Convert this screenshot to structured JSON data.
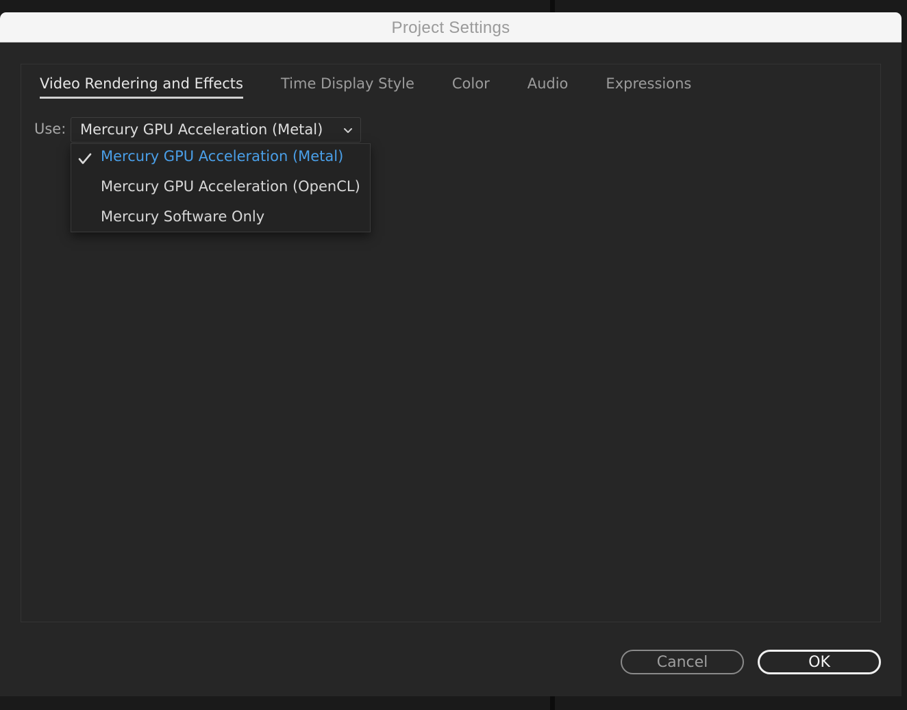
{
  "window": {
    "title": "Project Settings"
  },
  "tabs": [
    {
      "label": "Video Rendering and Effects",
      "active": true
    },
    {
      "label": "Time Display Style",
      "active": false
    },
    {
      "label": "Color",
      "active": false
    },
    {
      "label": "Audio",
      "active": false
    },
    {
      "label": "Expressions",
      "active": false
    }
  ],
  "renderer": {
    "use_label": "Use:",
    "selected_value": "Mercury GPU Acceleration (Metal)",
    "options": [
      {
        "label": "Mercury GPU Acceleration (Metal)",
        "selected": true
      },
      {
        "label": "Mercury GPU Acceleration (OpenCL)",
        "selected": false
      },
      {
        "label": "Mercury Software Only",
        "selected": false
      }
    ]
  },
  "buttons": {
    "cancel_label": "Cancel",
    "ok_label": "OK"
  },
  "colors": {
    "dialog_background": "#262626",
    "selected_option": "#4a9fe8",
    "titlebar": "#f5f5f5"
  },
  "icons": {
    "dropdown": "chevron-down-icon",
    "selected_option": "checkmark-icon"
  }
}
